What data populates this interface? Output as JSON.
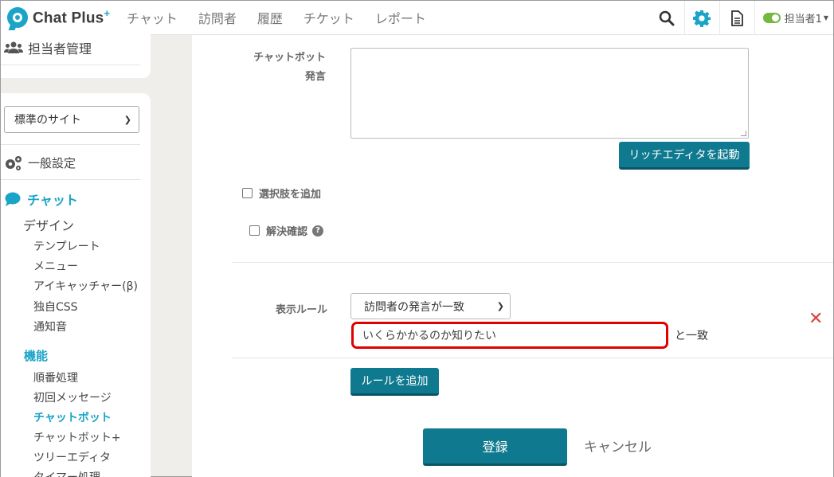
{
  "app": {
    "logo_text": "Chat Plus",
    "logo_plus": "+"
  },
  "nav": {
    "items": [
      "チャット",
      "訪問者",
      "履歴",
      "チケット",
      "レポート"
    ],
    "user_label": "担当者1"
  },
  "sidebar": {
    "agent_admin": "担当者管理",
    "site_select": "標準のサイト",
    "general_settings": "一般設定",
    "chat_section": "チャット",
    "design": "デザイン",
    "design_items": [
      "テンプレート",
      "メニュー",
      "アイキャッチャー(β)",
      "独自CSS",
      "通知音"
    ],
    "features": "機能",
    "feature_items": [
      "順番処理",
      "初回メッセージ",
      "チャットボット",
      "チャットボット+",
      "ツリーエディタ",
      "タイマー処理"
    ],
    "active_item": "チャットボット"
  },
  "form": {
    "bot_label_line1": "チャットボット",
    "bot_label_line2": "発言",
    "rich_editor_button": "リッチエディタを起動",
    "add_choices_label": "選択肢を追加",
    "resolution_label": "解決確認",
    "display_rule_label": "表示ルール",
    "rule_select_value": "訪問者の発言が一致",
    "rule_input_value": "いくらかかるのか知りたい",
    "match_suffix": "と一致",
    "add_rule_button": "ルールを追加",
    "submit_button": "登録",
    "cancel_link": "キャンセル"
  },
  "colors": {
    "accent": "#1aa4c8",
    "button": "#0f7a8f",
    "highlight": "#e10000",
    "delete": "#d9443f"
  }
}
